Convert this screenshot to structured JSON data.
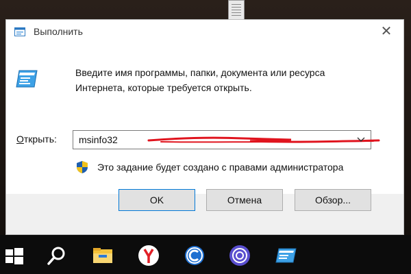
{
  "dialog": {
    "title": "Выполнить",
    "close_glyph": "✕",
    "description": "Введите имя программы, папки, документа или ресурса Интернета, которые требуется открыть.",
    "open_label_prefix": "",
    "open_label_accel": "О",
    "open_label_rest": "ткрыть:",
    "input_value": "msinfo32",
    "admin_note": "Это задание будет создано с правами администратора",
    "buttons": {
      "ok": "OK",
      "cancel": "Отмена",
      "browse": "Обзор..."
    },
    "colors": {
      "accent": "#0078d7",
      "annotation_red": "#e0141e"
    }
  },
  "taskbar": {
    "items": [
      {
        "icon": "windows-start-icon"
      },
      {
        "icon": "search-icon"
      },
      {
        "icon": "file-explorer-icon"
      },
      {
        "icon": "yandex-browser-icon"
      },
      {
        "icon": "ccleaner-icon"
      },
      {
        "icon": "bittorrent-icon"
      },
      {
        "icon": "run-app-icon"
      }
    ]
  }
}
